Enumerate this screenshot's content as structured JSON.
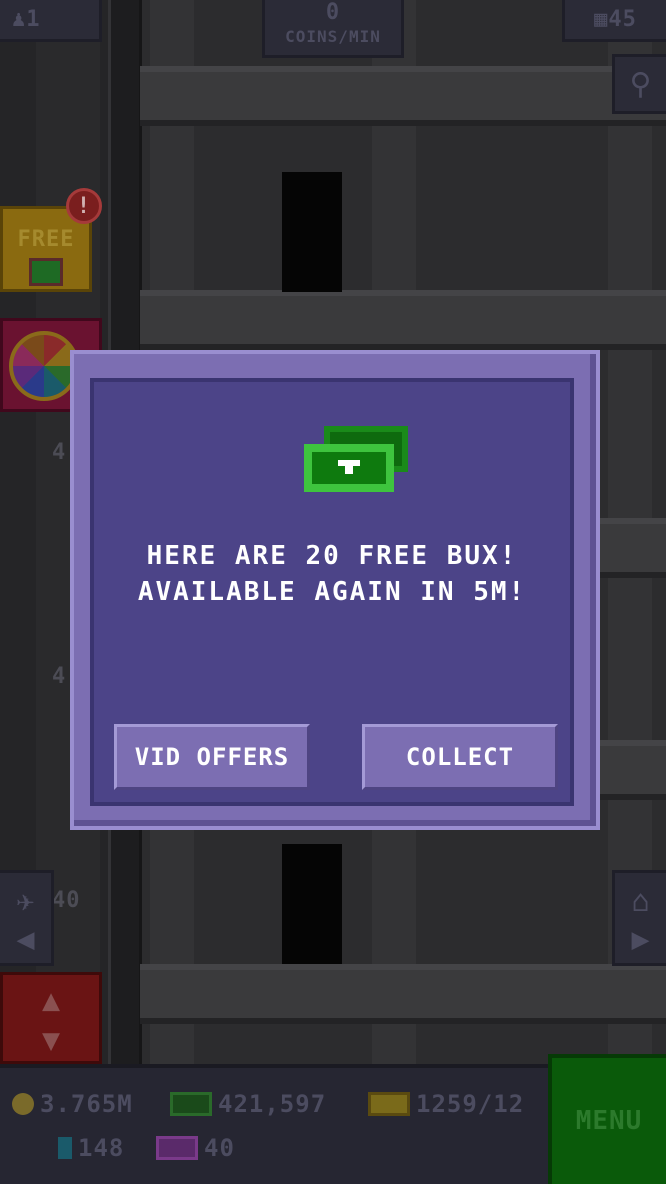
{
  "hud": {
    "population": "1",
    "coins_per_min_value": "0",
    "coins_per_min_label": "COINS/MIN",
    "floors": "45"
  },
  "side": {
    "free_label": "FREE",
    "alert_mark": "!",
    "floor_numbers": [
      "4",
      "4",
      "40"
    ]
  },
  "dialog": {
    "message_line1": "HERE ARE 20 FREE BUX!",
    "message_line2": "AVAILABLE AGAIN IN 5M!",
    "left_button": "VID OFFERS",
    "right_button": "COLLECT"
  },
  "bottom": {
    "coins": "3.765M",
    "bux": "421,597",
    "tickets": "1259/12",
    "gems": "148",
    "vip": "40",
    "menu_label": "MENU"
  },
  "icons": {
    "population": "person-icon",
    "floors": "building-icon",
    "search": "magnifier-icon",
    "coin": "coin-icon",
    "bux": "bux-icon",
    "ticket": "ticket-icon",
    "gem": "gem-icon",
    "vip": "vip-icon"
  },
  "colors": {
    "dialog_bg": "#4c4488",
    "dialog_frame": "#7c6eb2",
    "bux_green": "#2faa2f",
    "menu_green": "#0a5a0a"
  }
}
